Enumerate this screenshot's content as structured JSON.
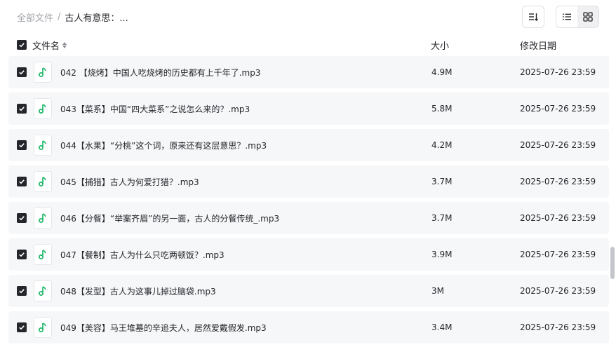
{
  "breadcrumb": {
    "root": "全部文件",
    "separator": "/",
    "current": "古人有意思：..."
  },
  "toolbar": {
    "sort_icon": "sort-descending-icon",
    "list_view_icon": "list-view-icon",
    "grid_view_icon": "grid-view-icon",
    "active_view": "list"
  },
  "table": {
    "headers": {
      "name": "文件名",
      "size": "大小",
      "modified": "修改日期"
    },
    "rows": [
      {
        "name": "042 【烧烤】中国人吃烧烤的历史都有上千年了.mp3",
        "size": "4.9M",
        "modified": "2025-07-26 23:59",
        "checked": true
      },
      {
        "name": "043【菜系】中国“四大菜系”之说怎么来的？.mp3",
        "size": "5.8M",
        "modified": "2025-07-26 23:59",
        "checked": true
      },
      {
        "name": "044【水果】“分桃”这个词，原来还有这层意思？.mp3",
        "size": "4.2M",
        "modified": "2025-07-26 23:59",
        "checked": true
      },
      {
        "name": "045【捕猎】古人为何爱打猎？.mp3",
        "size": "3.7M",
        "modified": "2025-07-26 23:59",
        "checked": true
      },
      {
        "name": "046【分餐】“举案齐眉”的另一面，古人的分餐传统_.mp3",
        "size": "3.7M",
        "modified": "2025-07-26 23:59",
        "checked": true
      },
      {
        "name": "047【餐制】古人为什么只吃两顿饭？.mp3",
        "size": "3.9M",
        "modified": "2025-07-26 23:59",
        "checked": true
      },
      {
        "name": "048【发型】古人为这事儿掉过脑袋.mp3",
        "size": "3M",
        "modified": "2025-07-26 23:59",
        "checked": true
      },
      {
        "name": "049【美容】马王堆墓的辛追夫人，居然爱戴假发.mp3",
        "size": "3.4M",
        "modified": "2025-07-26 23:59",
        "checked": true
      }
    ]
  },
  "colors": {
    "audio_icon": "#1fb76a",
    "checkbox": "#25262b",
    "row_bg": "#f6f7f9"
  }
}
